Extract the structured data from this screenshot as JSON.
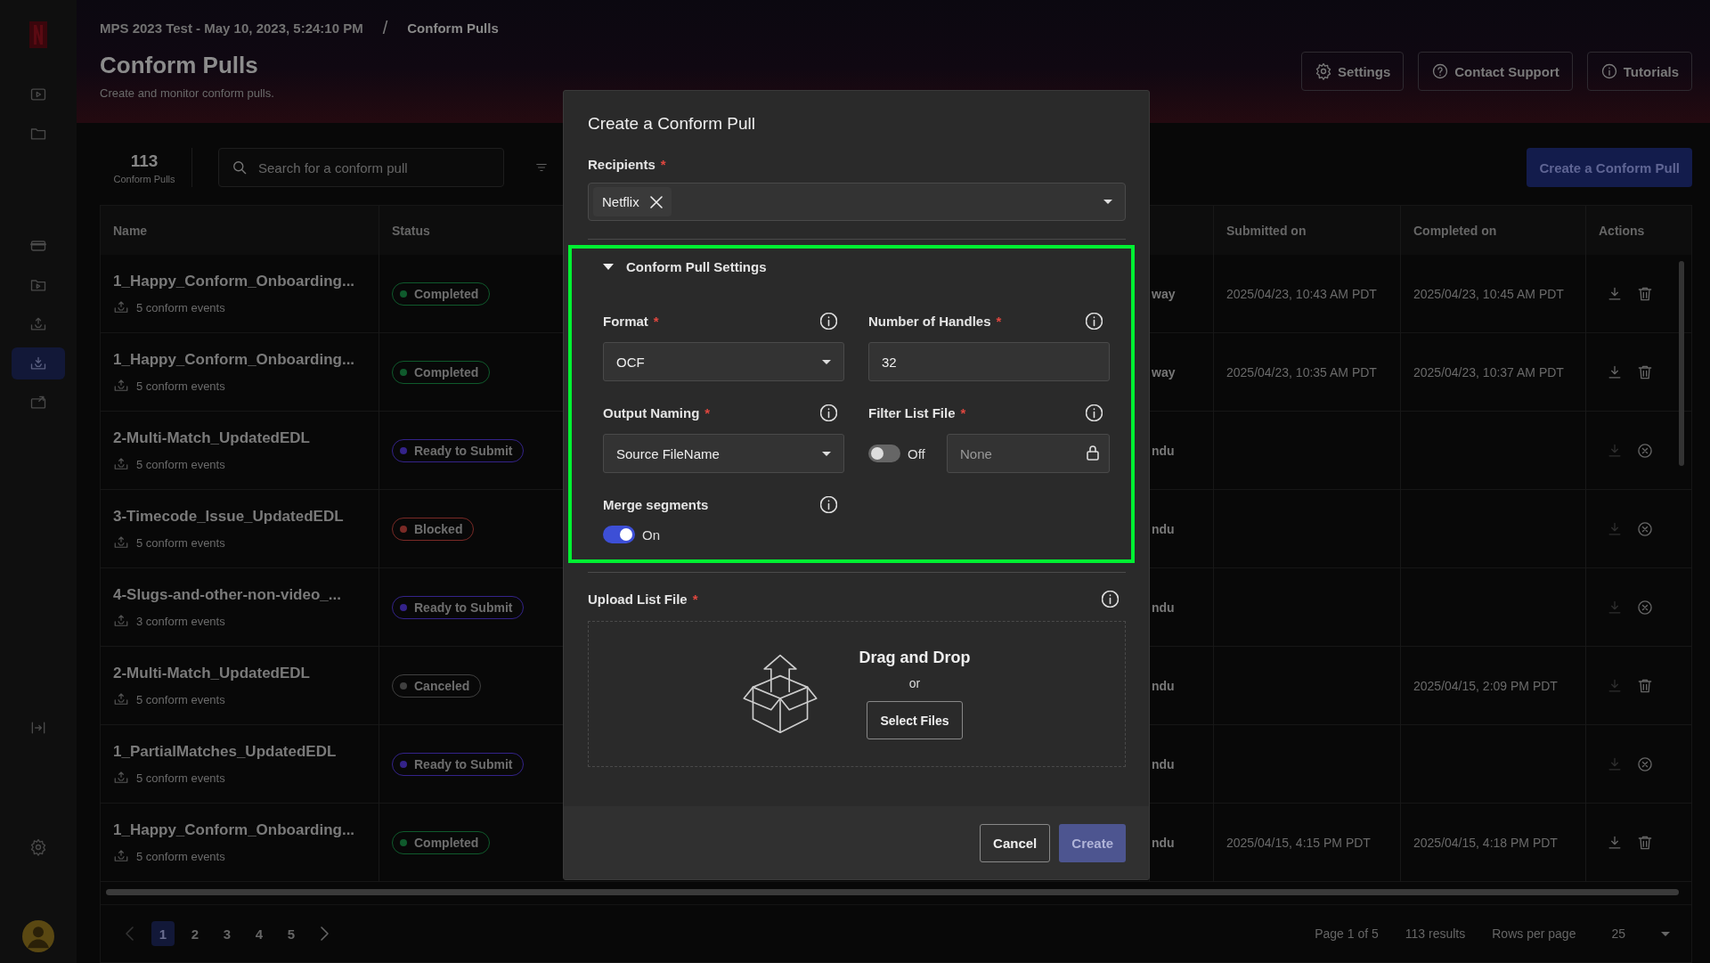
{
  "sidebar": {
    "nav_items": [
      {
        "kind": "video",
        "selected": false
      },
      {
        "kind": "folder",
        "selected": false
      },
      {
        "kind": "card",
        "selected": false
      },
      {
        "kind": "video-folder",
        "selected": false
      },
      {
        "kind": "tray-up",
        "selected": false
      },
      {
        "kind": "tray-down",
        "selected": true
      },
      {
        "kind": "tray-out",
        "selected": false
      }
    ],
    "footer_items": [
      {
        "kind": "collapse"
      },
      {
        "kind": "settings"
      },
      {
        "kind": "avatar"
      }
    ]
  },
  "header": {
    "breadcrumb": [
      "MPS 2023 Test - May 10, 2023, 5:24:10 PM",
      "Conform Pulls"
    ],
    "separator": "/",
    "title": "Conform Pulls",
    "subtitle": "Create and monitor conform pulls.",
    "buttons": [
      {
        "kind": "settings",
        "label": "Settings"
      },
      {
        "kind": "support",
        "label": "Contact Support"
      },
      {
        "kind": "info",
        "label": "Tutorials"
      }
    ]
  },
  "toolbar": {
    "count": "113",
    "count_label": "Conform Pulls",
    "search": {
      "placeholder": "Search for a conform pull"
    },
    "create_button": "Create a Conform Pull"
  },
  "table": {
    "columns": [
      "Name",
      "Status",
      "Submitted on",
      "Completed on",
      "Actions"
    ],
    "rows": [
      {
        "name": "1_Happy_Conform_Onboarding...",
        "events": "5 conform events",
        "status": {
          "label": "Completed",
          "color": "#0f5a2c"
        },
        "column_3": "way",
        "submitted": "2025/04/23, 10:43 AM PDT",
        "completed": "2025/04/23, 10:45 AM PDT",
        "actions": [
          {
            "kind": "download",
            "disabled": false
          },
          {
            "kind": "delete",
            "disabled": false
          }
        ]
      },
      {
        "name": "1_Happy_Conform_Onboarding...",
        "events": "5 conform events",
        "status": {
          "label": "Completed",
          "color": "#0f5a2c"
        },
        "column_3": "way",
        "submitted": "2025/04/23, 10:35 AM PDT",
        "completed": "2025/04/23, 10:37 AM PDT",
        "actions": [
          {
            "kind": "download",
            "disabled": false
          },
          {
            "kind": "delete",
            "disabled": false
          }
        ]
      },
      {
        "name": "2-Multi-Match_UpdatedEDL",
        "events": "5 conform events",
        "status": {
          "label": "Ready to Submit",
          "color": "#34238a"
        },
        "column_3": "ndu",
        "actions": [
          {
            "kind": "download",
            "disabled": true
          },
          {
            "kind": "cancel",
            "disabled": false
          }
        ]
      },
      {
        "name": "3-Timecode_Issue_UpdatedEDL",
        "events": "5 conform events",
        "status": {
          "label": "Blocked",
          "color": "#7a2a26"
        },
        "column_3": "ndu",
        "actions": [
          {
            "kind": "download",
            "disabled": true
          },
          {
            "kind": "cancel",
            "disabled": false
          }
        ]
      },
      {
        "name": "4-Slugs-and-other-non-video_...",
        "events": "3 conform events",
        "status": {
          "label": "Ready to Submit",
          "color": "#34238a"
        },
        "column_3": "ndu",
        "actions": [
          {
            "kind": "download",
            "disabled": true
          },
          {
            "kind": "cancel",
            "disabled": false
          }
        ]
      },
      {
        "name": "2-Multi-Match_UpdatedEDL",
        "events": "5 conform events",
        "status": {
          "label": "Canceled",
          "color": "#404040"
        },
        "column_3": "ndu",
        "completed": "2025/04/15, 2:09 PM PDT",
        "actions": [
          {
            "kind": "download",
            "disabled": true
          },
          {
            "kind": "delete",
            "disabled": false
          }
        ]
      },
      {
        "name": "1_PartialMatches_UpdatedEDL",
        "events": "5 conform events",
        "status": {
          "label": "Ready to Submit",
          "color": "#34238a"
        },
        "column_3": "ndu",
        "actions": [
          {
            "kind": "download",
            "disabled": true
          },
          {
            "kind": "cancel",
            "disabled": false
          }
        ]
      },
      {
        "name": "1_Happy_Conform_Onboarding...",
        "events": "5 conform events",
        "status": {
          "label": "Completed",
          "color": "#0f5a2c"
        },
        "column_3": "ndu",
        "submitted": "2025/04/15, 4:15 PM PDT",
        "completed": "2025/04/15, 4:18 PM PDT",
        "actions": [
          {
            "kind": "download",
            "disabled": false
          },
          {
            "kind": "delete",
            "disabled": false
          }
        ]
      }
    ]
  },
  "pagination": {
    "pages": [
      {
        "label": "1",
        "selected": true
      },
      {
        "label": "2",
        "selected": false
      },
      {
        "label": "3",
        "selected": false
      },
      {
        "label": "4",
        "selected": false
      },
      {
        "label": "5",
        "selected": false
      }
    ],
    "page_info": "Page 1 of 5",
    "results": "113 results",
    "rows_per_page_label": "Rows per page",
    "rows_per_page": "25"
  },
  "modal": {
    "title": "Create a Conform Pull",
    "recipients": {
      "label": "Recipients",
      "required_mark": "*",
      "chips": [
        "Netflix"
      ]
    },
    "settings": {
      "title": "Conform Pull Settings",
      "expanded": true,
      "highlighted": true,
      "fields": [
        {
          "kind": "select",
          "label": "Format",
          "required_mark": "*",
          "value": "OCF"
        },
        {
          "kind": "input",
          "label": "Number of Handles",
          "required_mark": "*",
          "value": "32"
        },
        {
          "kind": "select",
          "label": "Output Naming",
          "required_mark": "*",
          "value": "Source FileName"
        },
        {
          "kind": "toggle_input",
          "label": "Filter List File",
          "required_mark": "*",
          "on": false,
          "toggle_label": "Off",
          "placeholder": "None"
        },
        {
          "kind": "toggle",
          "label": "Merge segments",
          "on": true,
          "toggle_label": "On"
        }
      ]
    },
    "upload": {
      "label": "Upload List File",
      "required_mark": "*",
      "title": "Drag and Drop",
      "separator": "or",
      "button": "Select Files"
    },
    "buttons": [
      {
        "kind": "secondary",
        "label": "Cancel",
        "disabled": false
      },
      {
        "kind": "primary",
        "label": "Create",
        "disabled": true
      }
    ]
  }
}
